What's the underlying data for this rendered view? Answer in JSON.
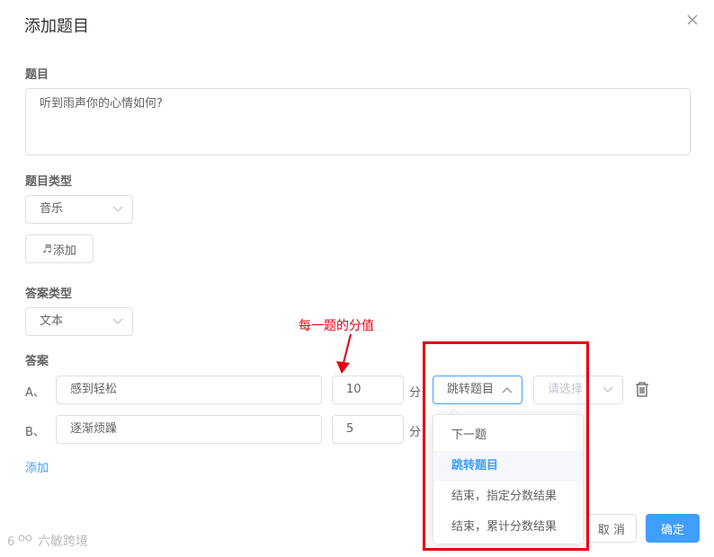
{
  "dialog": {
    "title": "添加题目"
  },
  "question": {
    "label": "题目",
    "text": "听到雨声你的心情如何?"
  },
  "question_type": {
    "label": "题目类型",
    "selected": "音乐",
    "add_button": "添加",
    "add_icon": "music-note-icon"
  },
  "answer_type": {
    "label": "答案类型",
    "selected": "文本"
  },
  "answers": {
    "label": "答案",
    "rows": [
      {
        "prefix": "A、",
        "text": "感到轻松",
        "score": "10",
        "unit": "分",
        "action": "跳转题目",
        "target_placeholder": "请选择"
      },
      {
        "prefix": "B、",
        "text": "逐渐烦躁",
        "score": "5",
        "unit": "分"
      }
    ],
    "add_link": "添加"
  },
  "dropdown": {
    "items": [
      "下一题",
      "跳转题目",
      "结束，指定分数结果",
      "结束，累计分数结果"
    ],
    "selected_index": 1
  },
  "footer": {
    "cancel": "取 消",
    "confirm": "确定"
  },
  "annotation": {
    "text": "每一题的分值",
    "color": "#e60012"
  },
  "watermark": {
    "text": "六敏跨境"
  },
  "colors": {
    "primary": "#409eff",
    "border": "#dcdfe6",
    "annotation": "#e60012"
  }
}
